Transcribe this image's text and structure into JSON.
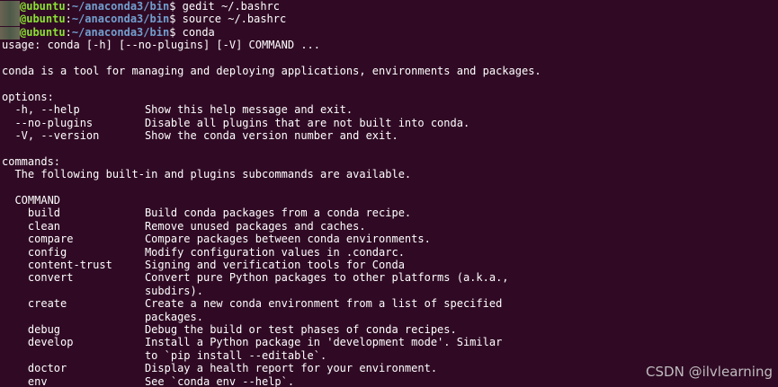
{
  "prompts": [
    {
      "user": "@ubuntu",
      "sep": ":",
      "path": "~/anaconda3/bin",
      "sign": "$ ",
      "command": "gedit ~/.bashrc"
    },
    {
      "user": "@ubuntu",
      "sep": ":",
      "path": "~/anaconda3/bin",
      "sign": "$ ",
      "command": "source ~/.bashrc"
    },
    {
      "user": "@ubuntu",
      "sep": ":",
      "path": "~/anaconda3/bin",
      "sign": "$ ",
      "command": "conda"
    }
  ],
  "output": [
    "usage: conda [-h] [--no-plugins] [-V] COMMAND ...",
    "",
    "conda is a tool for managing and deploying applications, environments and packages.",
    "",
    "options:",
    "  -h, --help          Show this help message and exit.",
    "  --no-plugins        Disable all plugins that are not built into conda.",
    "  -V, --version       Show the conda version number and exit.",
    "",
    "commands:",
    "  The following built-in and plugins subcommands are available.",
    "",
    "  COMMAND",
    "    build             Build conda packages from a conda recipe.",
    "    clean             Remove unused packages and caches.",
    "    compare           Compare packages between conda environments.",
    "    config            Modify configuration values in .condarc.",
    "    content-trust     Signing and verification tools for Conda",
    "    convert           Convert pure Python packages to other platforms (a.k.a.,",
    "                      subdirs).",
    "    create            Create a new conda environment from a list of specified",
    "                      packages.",
    "    debug             Debug the build or test phases of conda recipes.",
    "    develop           Install a Python package in 'development mode'. Similar",
    "                      to `pip install --editable`.",
    "    doctor            Display a health report for your environment.",
    "    env               See `conda env --help`."
  ],
  "watermark": "CSDN @ilvlearning",
  "colors": {
    "background": "#300a24",
    "user": "#8ae234",
    "path": "#729fcf",
    "text": "#ffffff"
  }
}
